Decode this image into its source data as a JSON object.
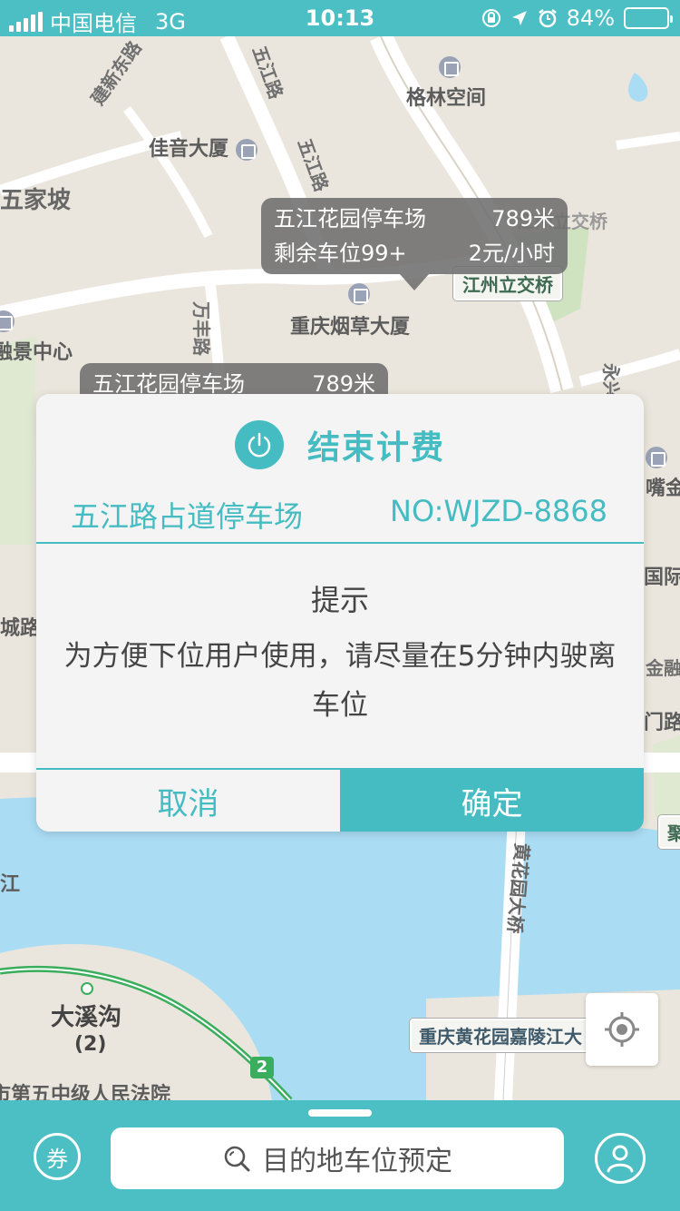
{
  "status_bar": {
    "carrier": "中国电信",
    "network": "3G",
    "time": "10:13",
    "battery": "84%",
    "battery_level": 0.84
  },
  "map": {
    "labels": {
      "jianxin_east_road": "建新东路",
      "wujiang_road_1": "五江路",
      "wujiang_road_2": "五江路",
      "gelin_space": "格林空间",
      "jiayin_building": "佳音大厦",
      "wujiapo": "五家坡",
      "tobacco_building": "重庆烟草大厦",
      "jiangzhou_bridge_tag": "江州立交桥",
      "rongjing_center": "融景中心",
      "wanfeng_road": "万丰路",
      "jiangzhou_road_faint": "江州立交桥",
      "zuijin": "嘴金",
      "guoji": "国际",
      "jinrong": "金融",
      "chenglu": "城路",
      "menlu": "门路",
      "ju": "聚",
      "jiang": "江",
      "daxigou": "大溪沟",
      "daxigou_num": "(2)",
      "court": "市第五中级人民法院",
      "huanghuayuan_bridge_road": "黄花园大桥",
      "huanghuayuan_bridge_tag": "重庆黄花园嘉陵江大",
      "route_badge": "2",
      "yongxing": "永兴"
    },
    "bubble_main": {
      "name": "五江花园停车场",
      "distance": "789米",
      "spaces": "剩余车位99+",
      "price": "2元/小时"
    },
    "bubble_second": {
      "name": "五江花园停车场",
      "distance": "789米"
    },
    "locate_icon": "crosshair-icon"
  },
  "dialog": {
    "title": "结束计费",
    "lot_name": "五江路占道停车场",
    "lot_no": "NO:WJZD-8868",
    "hint_title": "提示",
    "hint_text": "为方便下位用户使用，请尽量在5分钟内驶离车位",
    "cancel": "取消",
    "confirm": "确定",
    "accent_color": "#45bcc2"
  },
  "bottom_bar": {
    "coupon_label": "券",
    "search_text": "目的地车位预定",
    "profile_icon": "user-icon"
  }
}
